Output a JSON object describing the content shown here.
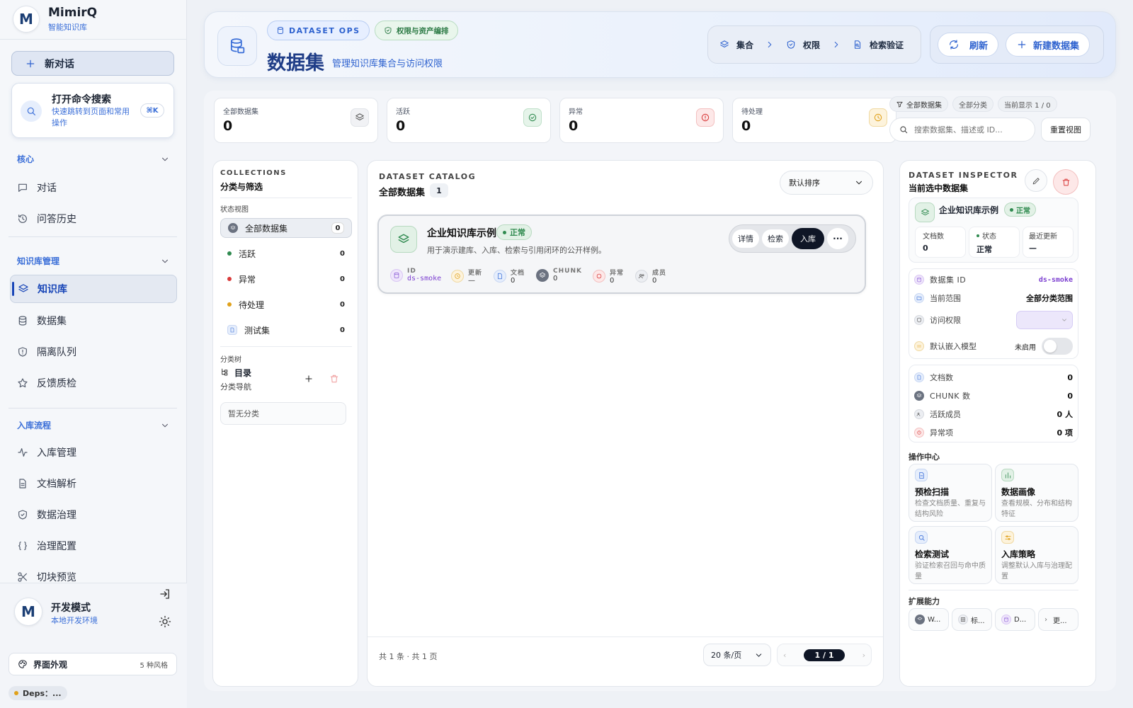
{
  "brand": {
    "name": "MimirQ",
    "subtitle": "智能知识库"
  },
  "sidebar": {
    "new_chat": "新对话",
    "command": {
      "title": "打开命令搜索",
      "desc": "快速跳转到页面和常用操作",
      "shortcut": "⌘K"
    },
    "sections": [
      {
        "label": "核心",
        "items": [
          "对话",
          "问答历史"
        ]
      },
      {
        "label": "知识库管理",
        "items": [
          "知识库",
          "数据集",
          "隔离队列",
          "反馈质检"
        ]
      },
      {
        "label": "入库流程",
        "items": [
          "入库管理",
          "文档解析",
          "数据治理",
          "治理配置",
          "切块预览"
        ]
      }
    ],
    "active_item": "知识库",
    "dev": {
      "title": "开发模式",
      "subtitle": "本地开发环境"
    },
    "appearance": {
      "label": "界面外观",
      "count": "5 种风格"
    },
    "deps": "Deps：..."
  },
  "header": {
    "chip_ops": "DATASET OPS",
    "chip_perm": "权限与资产编排",
    "title": "数据集",
    "subtitle": "管理知识库集合与访问权限",
    "crumbs": [
      "集合",
      "权限",
      "检索验证"
    ],
    "refresh": "刷新",
    "new_dataset": "新建数据集"
  },
  "stats": [
    {
      "label": "全部数据集",
      "value": "0",
      "icon": "layers-icon",
      "color": "#6b7280"
    },
    {
      "label": "活跃",
      "value": "0",
      "icon": "check-circle-icon",
      "color": "#2f8a4f"
    },
    {
      "label": "异常",
      "value": "0",
      "icon": "alert-circle-icon",
      "color": "#d93a3a"
    },
    {
      "label": "待处理",
      "value": "0",
      "icon": "clock-icon",
      "color": "#e0a11b"
    }
  ],
  "filters": {
    "chips": [
      "全部数据集",
      "全部分类",
      "当前显示 1 / 0"
    ],
    "search_placeholder": "搜索数据集、描述或 ID...",
    "reset": "重置视图"
  },
  "collections": {
    "eyebrow": "COLLECTIONS",
    "title": "分类与筛选",
    "status_label": "状态视图",
    "items": [
      {
        "label": "全部数据集",
        "count": "0"
      },
      {
        "label": "活跃",
        "count": "0",
        "color": "#2f8a4f"
      },
      {
        "label": "异常",
        "count": "0",
        "color": "#d93a3a"
      },
      {
        "label": "待处理",
        "count": "0",
        "color": "#e0a11b"
      },
      {
        "label": "测试集",
        "count": "0"
      }
    ],
    "tree_label": "分类树",
    "tree_title": "目录",
    "tree_sub": "分类导航",
    "empty": "暂无分类"
  },
  "catalog": {
    "eyebrow": "DATASET CATALOG",
    "title": "全部数据集",
    "count": "1",
    "sort": "默认排序",
    "card": {
      "name": "企业知识库示例",
      "status": "正常",
      "desc": "用于演示建库、入库、检索与引用闭环的公开样例。",
      "actions": [
        "详情",
        "检索",
        "入库"
      ],
      "meta": [
        {
          "k": "ID",
          "v": "ds-smoke"
        },
        {
          "k": "更新",
          "v": "—"
        },
        {
          "k": "文档",
          "v": "0"
        },
        {
          "k": "CHUNK",
          "v": "0"
        },
        {
          "k": "异常",
          "v": "0"
        },
        {
          "k": "成员",
          "v": "0"
        }
      ]
    },
    "footer": {
      "summary": "共 1 条 · 共 1 页",
      "page_size": "20 条/页",
      "page": "1 / 1"
    }
  },
  "inspector": {
    "eyebrow": "DATASET INSPECTOR",
    "title": "当前选中数据集",
    "name": "企业知识库示例",
    "status": "正常",
    "mini": [
      {
        "k": "文档数",
        "v": "0"
      },
      {
        "k": "状态",
        "v": "正常"
      },
      {
        "k": "最近更新",
        "v": "—"
      }
    ],
    "rows": [
      {
        "k": "数据集 ID",
        "v": "ds-smoke"
      },
      {
        "k": "当前范围",
        "v": "全部分类范围"
      },
      {
        "k": "访问权限",
        "v": ""
      },
      {
        "k": "默认嵌入模型",
        "v": "未启用"
      }
    ],
    "counts": [
      {
        "k": "文档数",
        "v": "0"
      },
      {
        "k": "CHUNK 数",
        "v": "0"
      },
      {
        "k": "活跃成员",
        "v": "0 人"
      },
      {
        "k": "异常项",
        "v": "0 项"
      }
    ],
    "ops_label": "操作中心",
    "ops": [
      {
        "t": "预检扫描",
        "d": "检查文档质量、重复与结构风险"
      },
      {
        "t": "数据画像",
        "d": "查看规模、分布和结构特征"
      },
      {
        "t": "检索测试",
        "d": "验证检索召回与命中质量"
      },
      {
        "t": "入库策略",
        "d": "调整默认入库与治理配置"
      }
    ],
    "ext_label": "扩展能力",
    "ext": [
      "W...",
      "标...",
      "D...",
      "更..."
    ]
  }
}
